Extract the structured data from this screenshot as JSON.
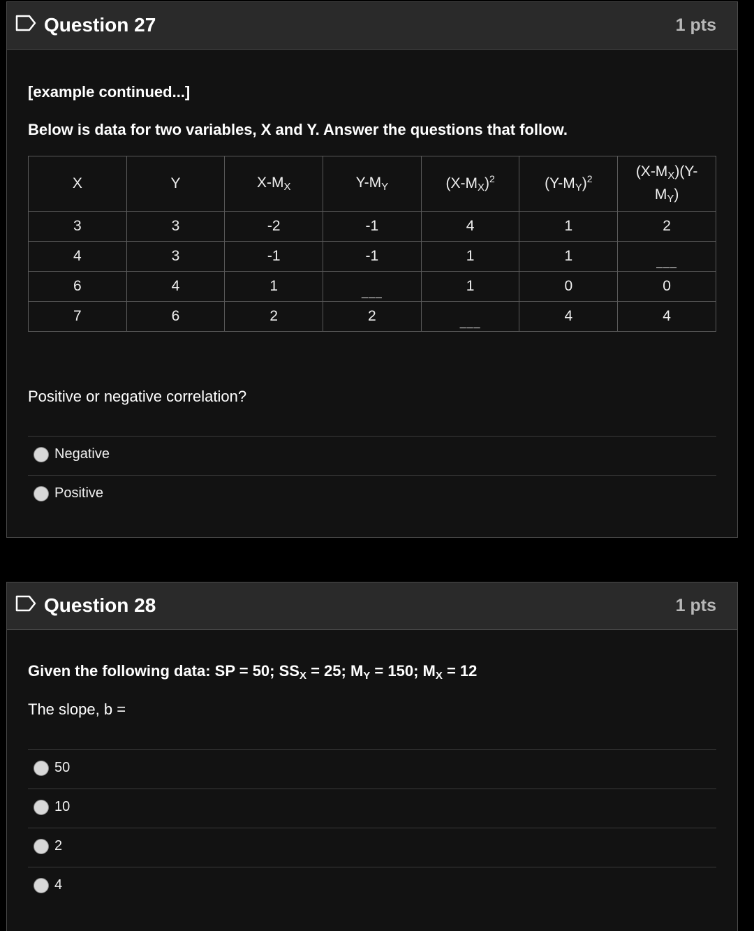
{
  "q27": {
    "title": "Question 27",
    "points": "1 pts",
    "intro": "[example continued...]",
    "instruction": "Below is data for two variables, X and Y.  Answer the questions that follow.",
    "table": {
      "headers": [
        "X",
        "Y",
        "X-M",
        "Y-M",
        "(X-M",
        "(Y-M",
        "(X-M"
      ],
      "rows": [
        [
          "3",
          "3",
          "-2",
          "-1",
          "4",
          "1",
          "2"
        ],
        [
          "4",
          "3",
          "-1",
          "-1",
          "1",
          "1",
          "___"
        ],
        [
          "6",
          "4",
          "1",
          "___",
          "1",
          "0",
          "0"
        ],
        [
          "7",
          "6",
          "2",
          "2",
          "___",
          "4",
          "4"
        ]
      ]
    },
    "question": "Positive or negative correlation?",
    "choices": [
      "Negative",
      "Positive"
    ]
  },
  "q28": {
    "title": "Question 28",
    "points": "1 pts",
    "data_line": "Given the following data: SP = 50; SS",
    "prompt": "The slope, b =",
    "choices": [
      "50",
      "10",
      "2",
      "4"
    ]
  },
  "colors": {
    "page_bg": "#000000",
    "panel_bg": "#121212",
    "header_bg": "#2a2a2a",
    "border": "#4a4a4a",
    "text": "#ffffff",
    "muted": "#b8b8b8"
  },
  "icons": [
    "flag-icon",
    "radio-icon"
  ]
}
